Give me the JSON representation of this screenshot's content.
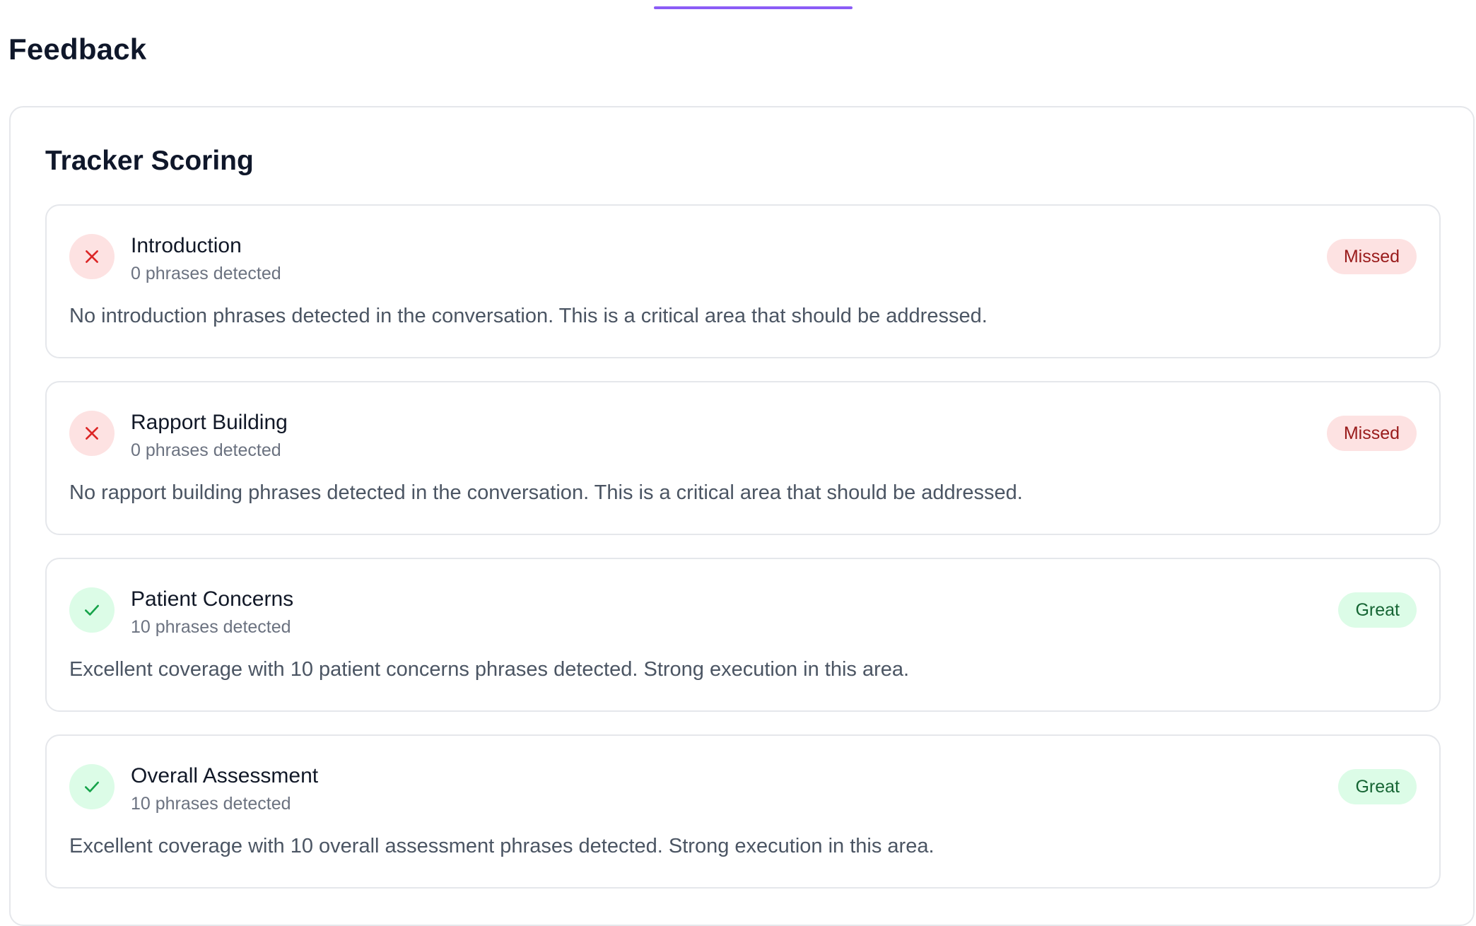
{
  "page": {
    "title": "Feedback"
  },
  "panel": {
    "title": "Tracker Scoring"
  },
  "colors": {
    "accent": "#8b5cf6",
    "missed_bg": "#fde2e2",
    "missed_fg": "#991b1b",
    "great_bg": "#dcfce7",
    "great_fg": "#166534"
  },
  "trackers": [
    {
      "name": "Introduction",
      "count": "0 phrases detected",
      "description": "No introduction phrases detected in the conversation. This is a critical area that should be addressed.",
      "status": "Missed",
      "icon": "x-icon"
    },
    {
      "name": "Rapport Building",
      "count": "0 phrases detected",
      "description": "No rapport building phrases detected in the conversation. This is a critical area that should be addressed.",
      "status": "Missed",
      "icon": "x-icon"
    },
    {
      "name": "Patient Concerns",
      "count": "10 phrases detected",
      "description": "Excellent coverage with 10 patient concerns phrases detected. Strong execution in this area.",
      "status": "Great",
      "icon": "check-icon"
    },
    {
      "name": "Overall Assessment",
      "count": "10 phrases detected",
      "description": "Excellent coverage with 10 overall assessment phrases detected. Strong execution in this area.",
      "status": "Great",
      "icon": "check-icon"
    }
  ]
}
